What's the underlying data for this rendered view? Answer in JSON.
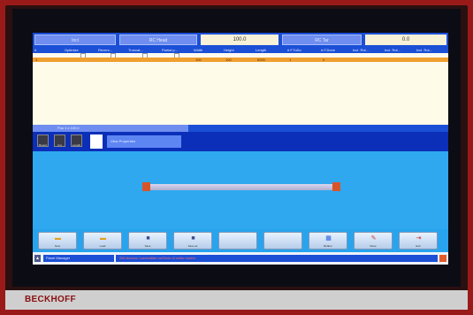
{
  "device": {
    "brand": "BECKHOFF"
  },
  "topbar": {
    "btn1": "Incl",
    "btn2": "RC Head",
    "value1": "100.0",
    "btn3": "RC Tar",
    "value2": "0.0"
  },
  "table": {
    "headers": [
      "#",
      "Optimize",
      "Revers...",
      "Truncat...",
      "Partial p...",
      "Width",
      "Height",
      "Length",
      "# F.ToDo",
      "# F.Done",
      "Incl. Rot...",
      "Incl. Rot...",
      "Incl. Rot..."
    ],
    "rows": [
      [
        "",
        "",
        "",
        "",
        "",
        "",
        "",
        "",
        "",
        "",
        "",
        "",
        ""
      ],
      [
        "1",
        "",
        "",
        "",
        "",
        "100",
        "100",
        "6000",
        "1",
        "0",
        "",
        "",
        ""
      ],
      [
        "",
        "",
        "",
        "",
        "",
        "",
        "",
        "",
        "",
        "",
        "",
        "",
        ""
      ]
    ]
  },
  "separator": {
    "label": "Pos 1 x 100.0"
  },
  "toolbar": {
    "tools": [
      "Bound",
      "Cut",
      "Length"
    ],
    "panel_label": "View Properties"
  },
  "buttons": [
    {
      "label": "New",
      "icon": "folder-icon"
    },
    {
      "label": "Load",
      "icon": "open-icon"
    },
    {
      "label": "Save",
      "icon": "save-icon"
    },
    {
      "label": "Save as",
      "icon": "save-as-icon"
    },
    {
      "label": "",
      "icon": ""
    },
    {
      "label": "",
      "icon": ""
    },
    {
      "label": "Buffers",
      "icon": "grid-icon"
    },
    {
      "label": "Move",
      "icon": "pen-icon"
    },
    {
      "label": "Exit",
      "icon": "exit-icon"
    }
  ],
  "status": {
    "left": "Panel Manager",
    "message": "280 Access: Lamenttitte ordTarm di verito motrici"
  },
  "colors": {
    "accent": "#1b4fd6",
    "highlight": "#f0a030",
    "preview": "#30a8f0"
  }
}
